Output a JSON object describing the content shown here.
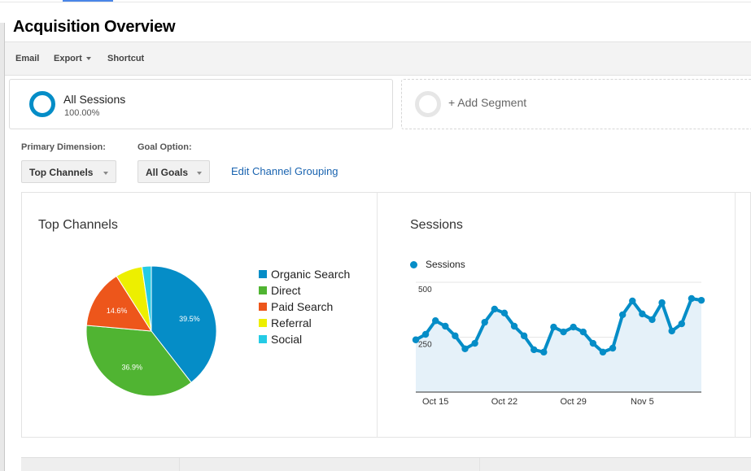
{
  "page": {
    "title": "Acquisition Overview"
  },
  "toolbar": {
    "email_label": "Email",
    "export_label": "Export",
    "shortcut_label": "Shortcut"
  },
  "segments": {
    "active": {
      "name": "All Sessions",
      "percent": "100.00%"
    },
    "add_label": "+ Add Segment"
  },
  "controls": {
    "primary_dimension_label": "Primary Dimension:",
    "primary_dimension_value": "Top Channels",
    "goal_option_label": "Goal Option:",
    "goal_option_value": "All Goals",
    "edit_link": "Edit Channel Grouping"
  },
  "colors": {
    "accent": "#058dc7",
    "link": "#1a64b0",
    "tab_indicator": "#4a86e8"
  },
  "chart_data": [
    {
      "type": "pie",
      "title": "Top Channels",
      "categories": [
        "Organic Search",
        "Direct",
        "Paid Search",
        "Referral",
        "Social"
      ],
      "values": [
        39.5,
        36.9,
        14.6,
        6.7,
        2.3
      ],
      "data_labels": [
        "39.5%",
        "36.9%",
        "14.6%",
        "",
        ""
      ],
      "colors": [
        "#058dc7",
        "#50b432",
        "#ed561b",
        "#edef00",
        "#24cbe5"
      ],
      "legend": "right"
    },
    {
      "type": "area",
      "title": "Sessions",
      "series": [
        {
          "name": "Sessions",
          "color": "#058dc7",
          "values": [
            238,
            263,
            325,
            300,
            256,
            197,
            222,
            318,
            378,
            360,
            300,
            256,
            193,
            182,
            296,
            274,
            296,
            274,
            222,
            182,
            200,
            352,
            415,
            356,
            330,
            407,
            278,
            311,
            426,
            418
          ]
        }
      ],
      "x_tick_labels": [
        "Oct 15",
        "Oct 22",
        "Oct 29",
        "Nov 5"
      ],
      "x_tick_indices": [
        2,
        9,
        16,
        23
      ],
      "y_tick_labels": [
        "250",
        "500"
      ],
      "y_ticks": [
        250,
        500
      ],
      "ylim": [
        0,
        500
      ],
      "grid": true,
      "legend": "top-left"
    }
  ]
}
